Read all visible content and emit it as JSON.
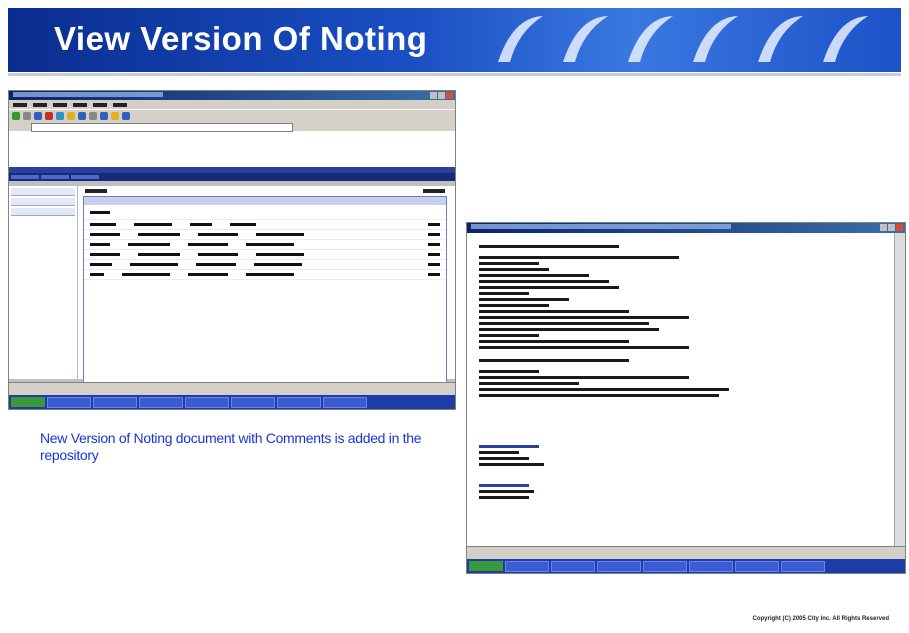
{
  "slide": {
    "title": "View Version Of Noting",
    "caption": "New Version of Noting document with Comments is added in the repository",
    "footer": "Copyright (C) 2005 City Inc. All Rights Reserved"
  },
  "colors": {
    "banner": "#1a4fc4",
    "caption_text": "#1b33d6",
    "taskbar": "#1e3ca8"
  }
}
